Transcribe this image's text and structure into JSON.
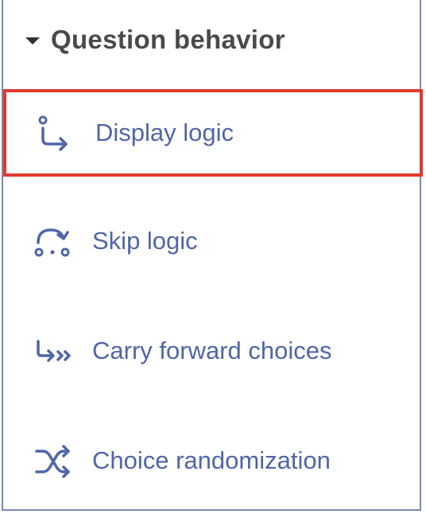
{
  "section": {
    "title": "Question behavior",
    "expanded": true
  },
  "items": [
    {
      "label": "Display logic",
      "icon": "display-logic-icon",
      "highlighted": true
    },
    {
      "label": "Skip logic",
      "icon": "skip-logic-icon",
      "highlighted": false
    },
    {
      "label": "Carry forward choices",
      "icon": "carry-forward-icon",
      "highlighted": false
    },
    {
      "label": "Choice randomization",
      "icon": "shuffle-icon",
      "highlighted": false
    }
  ],
  "colors": {
    "accent": "#5066a8",
    "highlight": "#e03a2c",
    "title": "#4a4a4a",
    "border": "#7a88b8"
  }
}
